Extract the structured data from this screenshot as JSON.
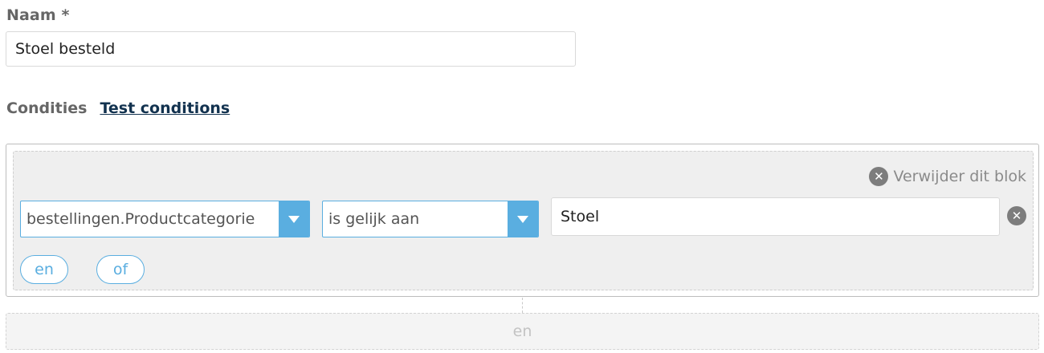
{
  "name_field": {
    "label": "Naam *",
    "value": "Stoel besteld"
  },
  "conditions": {
    "label": "Condities",
    "test_link": "Test conditions"
  },
  "block": {
    "remove_label": "Verwijder dit blok",
    "remove_icon": "close-circle-icon",
    "rule": {
      "field": "bestellingen.Productcategorie",
      "operator": "is gelijk aan",
      "value": "Stoel",
      "remove_icon": "close-circle-icon"
    },
    "and_label": "en",
    "or_label": "of"
  },
  "add_block": {
    "label": "en"
  },
  "colors": {
    "accent": "#5aaee0",
    "link": "#12324f",
    "block_bg": "#efefef",
    "icon_gray": "#7d7d7d"
  }
}
